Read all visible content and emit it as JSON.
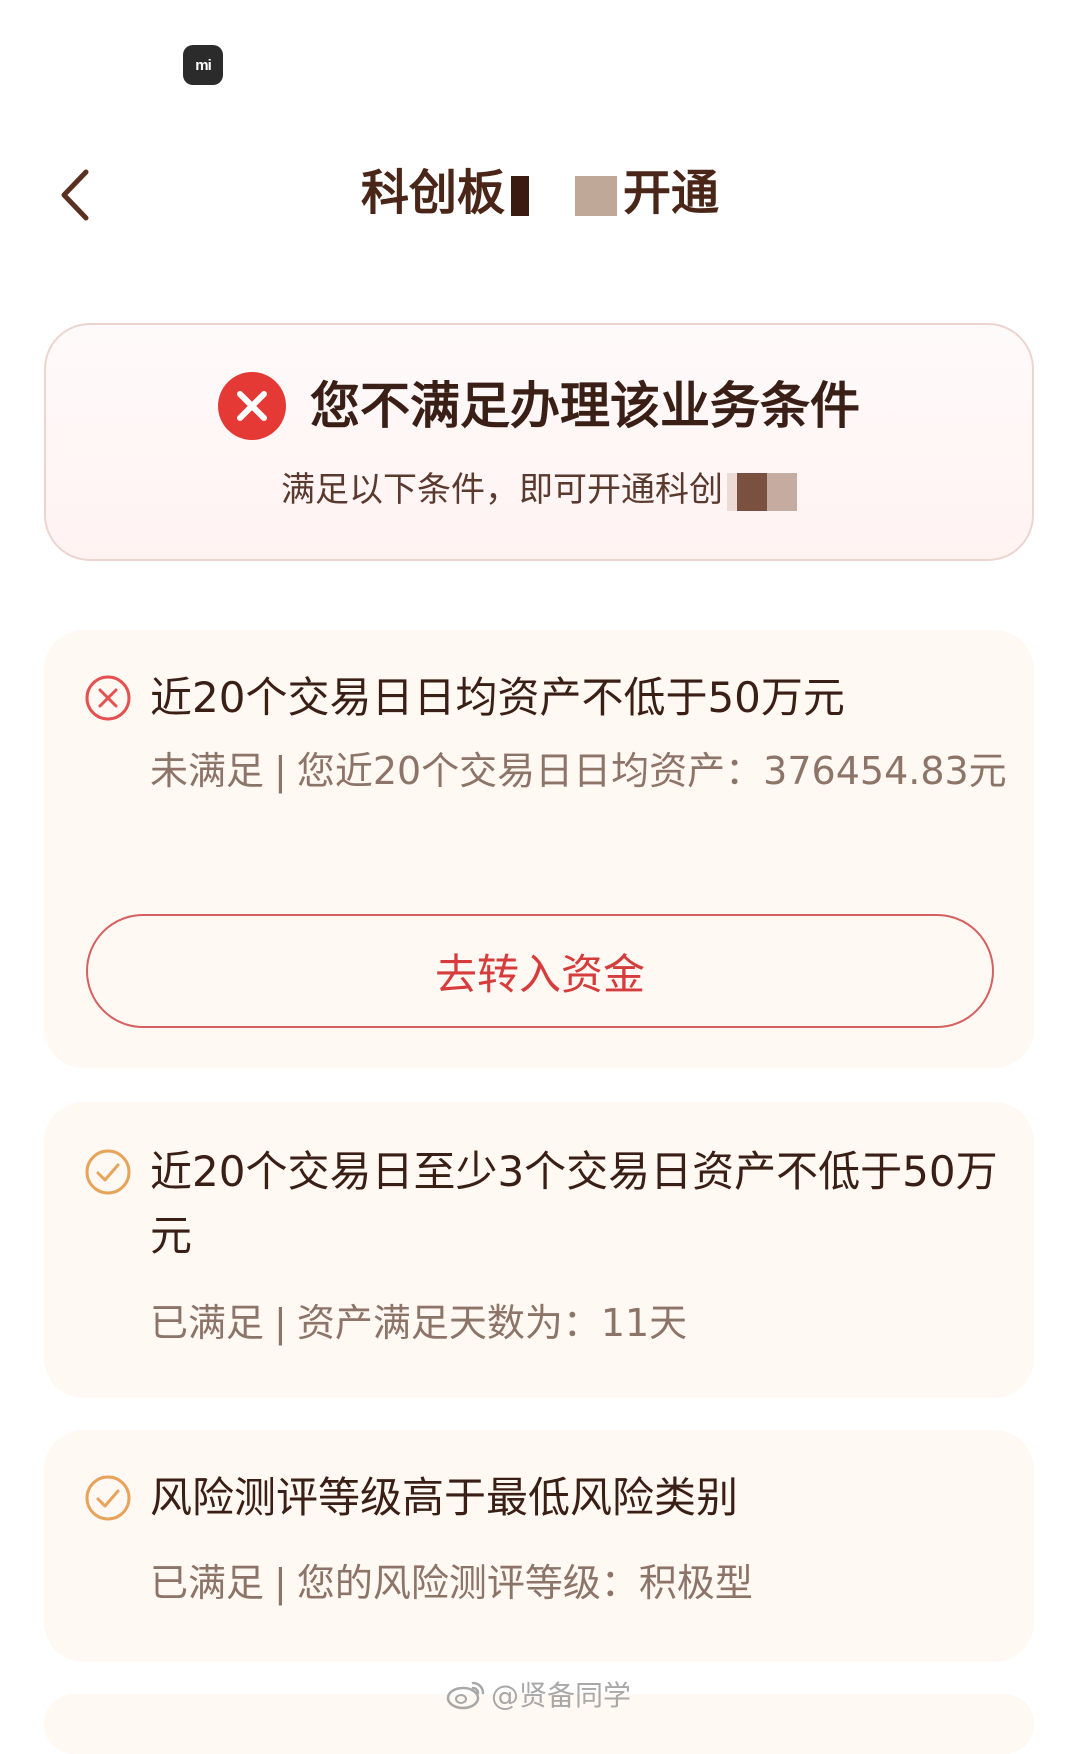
{
  "status_bar": {
    "logo_text": "mi"
  },
  "header": {
    "title_start": "科创板",
    "title_end": "开通"
  },
  "banner": {
    "title": "您不满足办理该业务条件",
    "subtitle": "满足以下条件，即可开通科创"
  },
  "conditions": [
    {
      "status": "unmet",
      "title": "近20个交易日日均资产不低于50万元",
      "status_label": "未满足",
      "separator": "|",
      "detail": "您近20个交易日日均资产：376454.83元",
      "button_label": "去转入资金"
    },
    {
      "status": "met",
      "title": "近20个交易日至少3个交易日资产不低于50万元",
      "status_label": "已满足",
      "separator": "|",
      "detail": "资产满足天数为：11天"
    },
    {
      "status": "met",
      "title": "风险测评等级高于最低风险类别",
      "status_label": "已满足",
      "separator": "|",
      "detail": "您的风险测评等级：积极型"
    }
  ],
  "watermark": {
    "text": "@贤备同学"
  },
  "colors": {
    "title": "#4a2618",
    "error_red": "#e53935",
    "met_orange": "#e8a35a",
    "button_red": "#d63c3c",
    "card_bg": "#fff8f3"
  },
  "icons": {
    "back": "chevron-left-icon",
    "error": "error-circle-icon",
    "unmet": "x-circle-icon",
    "met": "check-circle-icon",
    "weibo": "weibo-icon"
  }
}
